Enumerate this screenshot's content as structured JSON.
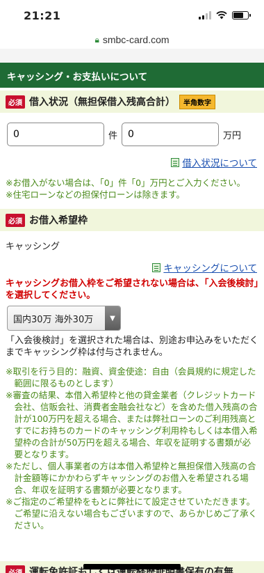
{
  "status": {
    "time": "21:21"
  },
  "browser": {
    "url": "smbc-card.com"
  },
  "section": {
    "title": "キャッシング・お支払いについて"
  },
  "loan_status": {
    "required": "必須",
    "label": "借入状況（無担保借入残高合計）",
    "badge": "半角数字",
    "count_value": "0",
    "count_unit": "件",
    "amount_value": "0",
    "amount_unit": "万円",
    "link": "借入状況について",
    "notes": [
      "※お借入がない場合は、「0」件「0」万円とご入力ください。",
      "※住宅ローンなどの担保付ローンは除きます。"
    ]
  },
  "credit_limit": {
    "required": "必須",
    "label": "お借入希望枠",
    "sub_label": "キャッシング",
    "link": "キャッシングについて",
    "warning": "キャッシングお借入枠をご希望されない場合は、「入会後検討」を選択してください。",
    "selected": "国内30万 海外30万",
    "info": "「入会後検討」を選択された場合は、別途お申込みをいただくまでキャッシング枠は付与されません。",
    "notes": [
      "※取引を行う目的：融資、資金使途：自由（会員規約に規定した範囲に限るものとします）",
      "※審査の結果、本借入希望枠と他の貸金業者（クレジットカード会社、信販会社、消費者金融会社など）を含めた借入残高の合計が100万円を超える場合、または弊社ローンのご利用残高とすでにお持ちのカードのキャッシング利用枠もしくは本借入希望枠の合計が50万円を超える場合、年収を証明する書類が必要となります。",
      "※ただし、個人事業者の方は本借入希望枠と無担保借入残高の合計金額等にかかわらずキャッシングのお借入を希望される場合、年収を証明する書類が必要となります。",
      "※ご指定のご希望枠をもとに弊社にて設定させていただきます。ご希望に沿えない場合もございますので、あらかじめご了承ください。"
    ]
  },
  "next_field": {
    "required": "必須",
    "label": "運転免許証もしくは運転経歴証明書保有の有無"
  }
}
